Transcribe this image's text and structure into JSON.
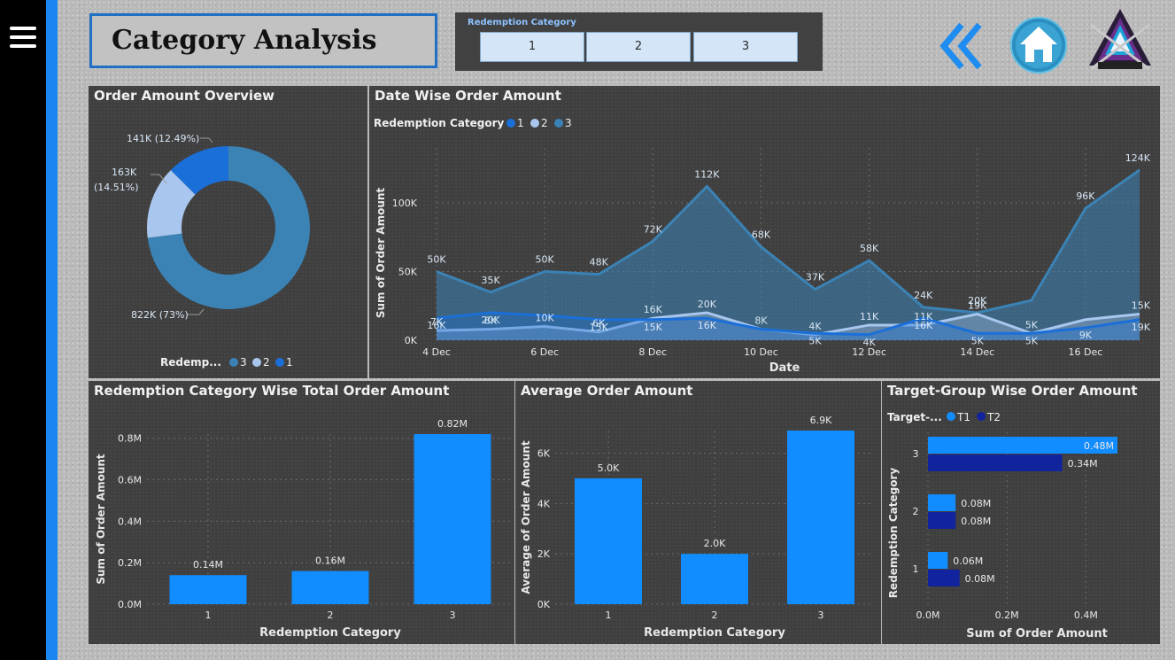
{
  "header": {
    "title": "Category Analysis",
    "slicer": {
      "label": "Redemption Category",
      "options": [
        "1",
        "2",
        "3"
      ]
    }
  },
  "nav": {
    "menu_icon": "hamburger-menu-icon",
    "back_icon": "double-chevron-left-icon",
    "home_icon": "home-icon"
  },
  "colors": {
    "cat1": "#1a6fd8",
    "cat2": "#a9c7ee",
    "cat3": "#3b82b5",
    "bar": "#118dff",
    "t2": "#12239e"
  },
  "chart_data": [
    {
      "id": "donut",
      "type": "pie",
      "title": "Order Amount Overview",
      "legend_title": "Redemp...",
      "legend_position": "bottom",
      "slices": [
        {
          "name": "3",
          "value": 822,
          "label": "822K (73%)",
          "color": "#3b82b5"
        },
        {
          "name": "2",
          "value": 163,
          "label": "163K (14.51%)",
          "color": "#a9c7ee"
        },
        {
          "name": "1",
          "value": 141,
          "label": "141K (12.49%)",
          "color": "#1a6fd8"
        }
      ]
    },
    {
      "id": "area",
      "type": "area",
      "title": "Date Wise Order Amount",
      "legend_title": "Redemption Category",
      "legend_position": "top-left",
      "xlabel": "Date",
      "ylabel": "Sum of Order Amount",
      "x": [
        4,
        5,
        6,
        7,
        8,
        9,
        10,
        11,
        12,
        13,
        14,
        15,
        16,
        17
      ],
      "xtick_labels": [
        "4 Dec",
        "6 Dec",
        "8 Dec",
        "10 Dec",
        "12 Dec",
        "14 Dec",
        "16 Dec"
      ],
      "xtick_values": [
        4,
        6,
        8,
        10,
        12,
        14,
        16
      ],
      "ytick_labels": [
        "0K",
        "50K",
        "100K"
      ],
      "ytick_values": [
        0,
        50,
        100
      ],
      "ylim": [
        0,
        140
      ],
      "series": [
        {
          "name": "3",
          "color": "#3b82b5",
          "values": [
            50,
            35,
            50,
            48,
            72,
            112,
            68,
            37,
            58,
            24,
            20,
            29,
            96,
            124
          ],
          "labels": [
            "50K",
            "35K",
            "50K",
            "48K",
            "72K",
            "112K",
            "68K",
            "37K",
            "58K",
            "24K",
            "20K",
            "",
            "96K",
            "124K"
          ]
        },
        {
          "name": "2",
          "color": "#a9c7ee",
          "values": [
            7,
            8,
            10,
            6,
            16,
            20,
            8,
            4,
            11,
            11,
            19,
            5,
            15,
            19
          ],
          "labels": [
            "7K",
            "8K",
            "10K",
            "6K",
            "16K",
            "20K",
            "8K",
            "4K",
            "11K",
            "11K",
            "19K",
            "5K",
            "",
            "15K"
          ]
        },
        {
          "name": "1",
          "color": "#1a6fd8",
          "values": [
            16,
            20,
            18,
            15,
            15,
            16,
            8,
            5,
            4,
            16,
            5,
            5,
            9,
            15
          ],
          "labels": [
            "16K",
            "20K",
            "",
            "15K",
            "15K",
            "16K",
            "",
            "5K",
            "4K",
            "16K",
            "5K",
            "5K",
            "9K",
            "19K"
          ]
        }
      ]
    },
    {
      "id": "bar1",
      "type": "bar",
      "title": "Redemption Category Wise Total Order Amount",
      "xlabel": "Redemption Category",
      "ylabel": "Sum of Order Amount",
      "categories": [
        "1",
        "2",
        "3"
      ],
      "values": [
        0.14,
        0.16,
        0.82
      ],
      "labels": [
        "0.14M",
        "0.16M",
        "0.82M"
      ],
      "ytick_labels": [
        "0.0M",
        "0.2M",
        "0.4M",
        "0.6M",
        "0.8M"
      ],
      "ytick_values": [
        0,
        0.2,
        0.4,
        0.6,
        0.8
      ],
      "ylim": [
        0,
        0.82
      ]
    },
    {
      "id": "bar2",
      "type": "bar",
      "title": "Average Order Amount",
      "xlabel": "Redemption Category",
      "ylabel": "Average of Order Amount",
      "categories": [
        "1",
        "2",
        "3"
      ],
      "values": [
        5.0,
        2.0,
        6.9
      ],
      "labels": [
        "5.0K",
        "2.0K",
        "6.9K"
      ],
      "ytick_labels": [
        "0K",
        "2K",
        "4K",
        "6K"
      ],
      "ytick_values": [
        0,
        2,
        4,
        6
      ],
      "ylim": [
        0,
        6.9
      ]
    },
    {
      "id": "hbar",
      "type": "bar",
      "title": "Target-Group Wise Order Amount",
      "legend_title": "Target-...",
      "legend_position": "top-left",
      "xlabel": "Sum of Order Amount",
      "ylabel": "Redemption Category",
      "categories": [
        "3",
        "2",
        "1"
      ],
      "xtick_labels": [
        "0.0M",
        "0.2M",
        "0.4M"
      ],
      "xtick_values": [
        0,
        0.2,
        0.4
      ],
      "xlim": [
        0,
        0.48
      ],
      "series": [
        {
          "name": "T1",
          "color": "#118dff",
          "values": [
            0.48,
            0.07,
            0.05
          ],
          "labels": [
            "0.48M",
            "0.08M",
            "0.06M"
          ]
        },
        {
          "name": "T2",
          "color": "#12239e",
          "values": [
            0.34,
            0.07,
            0.08
          ],
          "labels": [
            "0.34M",
            "0.08M",
            "0.08M"
          ]
        }
      ]
    }
  ]
}
